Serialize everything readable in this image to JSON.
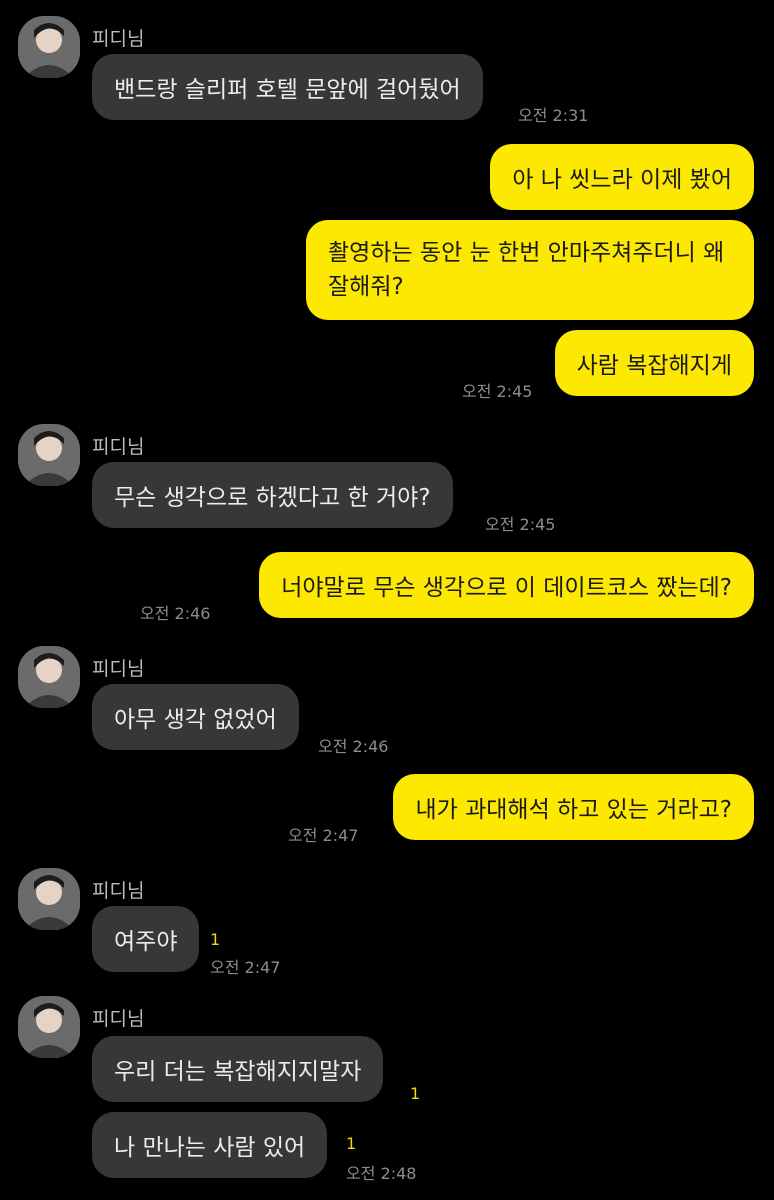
{
  "chat": {
    "sender_name": "피디님",
    "messages": [
      {
        "text": "밴드랑 슬리퍼 호텔 문앞에 걸어뒀어",
        "time": "오전 2:31"
      },
      {
        "text": "아 나 씻느라 이제 봤어"
      },
      {
        "text": "촬영하는 동안 눈 한번 안마주쳐주더니 왜 잘해줘?"
      },
      {
        "text": "사람 복잡해지게",
        "time": "오전 2:45"
      },
      {
        "text": "무슨 생각으로 하겠다고 한 거야?",
        "time": "오전 2:45"
      },
      {
        "text": "너야말로 무슨 생각으로 이 데이트코스 짰는데?",
        "time": "오전 2:46"
      },
      {
        "text": "아무 생각 없었어",
        "time": "오전 2:46"
      },
      {
        "text": "내가 과대해석 하고 있는 거라고?",
        "time": "오전 2:47"
      },
      {
        "text": "여주야",
        "time": "오전 2:47",
        "unread": "1"
      },
      {
        "text": "우리 더는 복잡해지지말자",
        "unread": "1"
      },
      {
        "text": "나 만나는 사람 있어",
        "time": "오전 2:48",
        "unread": "1"
      }
    ]
  },
  "colors": {
    "background": "#000000",
    "incoming_bubble": "#373737",
    "outgoing_bubble": "#fde801",
    "unread_badge": "#f5d50a"
  },
  "icons": {
    "avatar": "profile-photo-avatar-icon"
  }
}
